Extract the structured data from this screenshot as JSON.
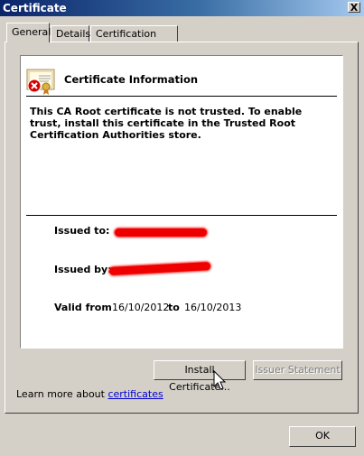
{
  "window": {
    "title": "Certificate",
    "close_glyph": "X"
  },
  "tabs": [
    {
      "label": "General",
      "active": true
    },
    {
      "label": "Details",
      "active": false
    },
    {
      "label": "Certification Path",
      "active": false
    }
  ],
  "info": {
    "heading": "Certificate Information",
    "warning": "This CA Root certificate is not trusted. To enable trust, install this certificate in the Trusted Root Certification Authorities store."
  },
  "fields": {
    "issued_to_label": "Issued to:",
    "issued_by_label": "Issued by:",
    "valid_from_label": "Valid from",
    "valid_from": "16/10/2012",
    "to_label": "to",
    "valid_to": "16/10/2013"
  },
  "buttons": {
    "install": "Install Certificate...",
    "issuer_statement": "Issuer Statement",
    "ok": "OK"
  },
  "learn_more": {
    "prefix": "Learn more about",
    "link": "certificates"
  },
  "colors": {
    "redaction": "#ee0000",
    "titlebar": "#0a246a",
    "link": "#0000cc"
  }
}
